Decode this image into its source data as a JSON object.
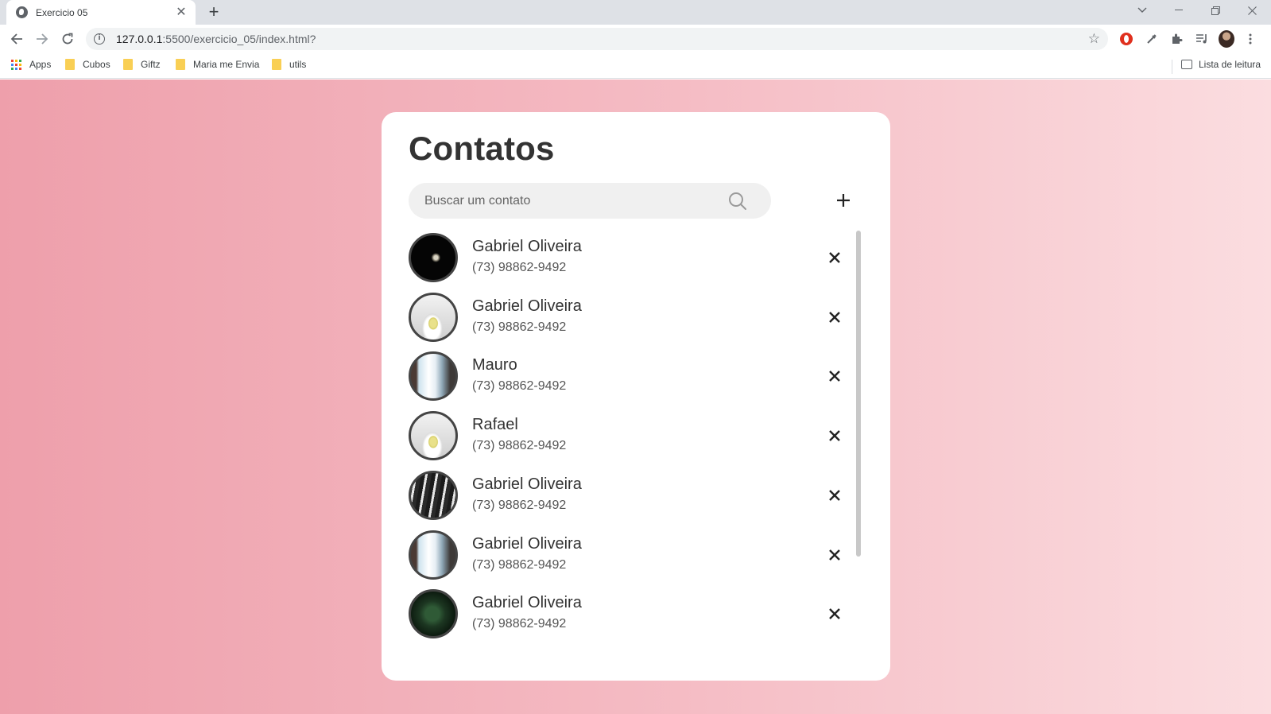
{
  "browser": {
    "tab_title": "Exercicio 05",
    "url_host": "127.0.0.1",
    "url_rest": ":5500/exercicio_05/index.html?",
    "bookmarks": [
      "Apps",
      "Cubos",
      "Giftz",
      "Maria me Envia",
      "utils"
    ],
    "reading_list": "Lista de leitura"
  },
  "app": {
    "title": "Contatos",
    "search_placeholder": "Buscar um contato",
    "contacts": [
      {
        "name": "Gabriel Oliveira",
        "phone": "(73) 98862-9492",
        "avatar": "moon-photo"
      },
      {
        "name": "Gabriel Oliveira",
        "phone": "(73) 98862-9492",
        "avatar": "lemon-photo"
      },
      {
        "name": "Mauro",
        "phone": "(73) 98862-9492",
        "avatar": "waterfall-photo"
      },
      {
        "name": "Rafael",
        "phone": "(73) 98862-9492",
        "avatar": "lemon-photo"
      },
      {
        "name": "Gabriel Oliveira",
        "phone": "(73) 98862-9492",
        "avatar": "forest-person-photo"
      },
      {
        "name": "Gabriel Oliveira",
        "phone": "(73) 98862-9492",
        "avatar": "waterfall-photo"
      },
      {
        "name": "Gabriel Oliveira",
        "phone": "(73) 98862-9492",
        "avatar": "leaves-photo"
      }
    ]
  },
  "colors": {
    "page_gradient_start": "#ee9fab",
    "page_gradient_end": "#fbdde0",
    "title": "#333333",
    "search_bg": "#f0f0f0"
  }
}
